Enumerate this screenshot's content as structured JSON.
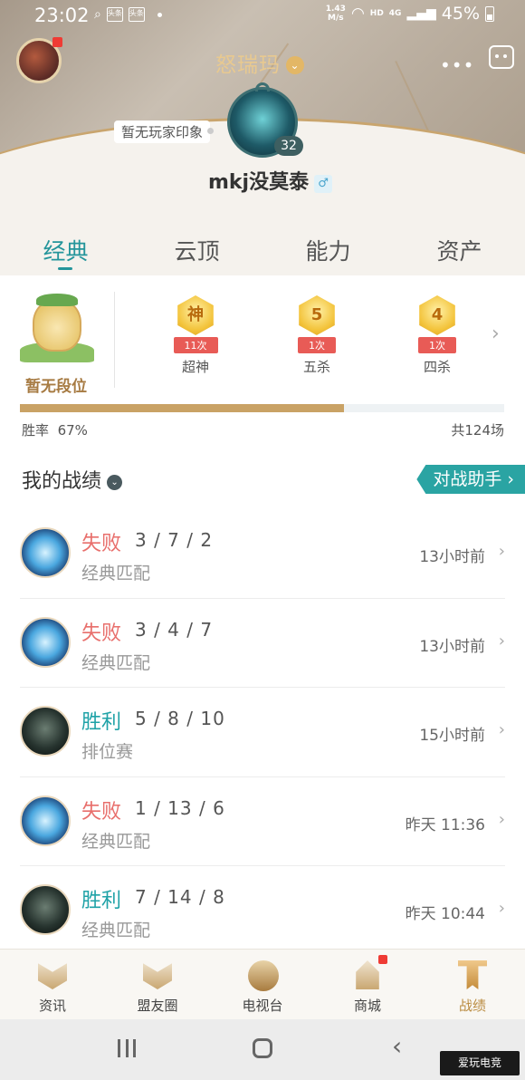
{
  "status_bar": {
    "time": "23:02",
    "notif_icons": [
      "头条",
      "头条"
    ],
    "net_speed_value": "1.43",
    "net_speed_unit": "M/s",
    "hd": "HD",
    "network": "4G",
    "battery": "45%"
  },
  "header": {
    "server_name": "怒瑞玛",
    "impression_tag": "暂无玩家印象",
    "level": "32",
    "player_name": "mkj没莫泰",
    "gender_symbol": "♂",
    "more_symbol": "•••"
  },
  "tabs": [
    {
      "label": "经典",
      "active": true
    },
    {
      "label": "云顶",
      "active": false
    },
    {
      "label": "能力",
      "active": false
    },
    {
      "label": "资产",
      "active": false
    }
  ],
  "summary": {
    "rank_label": "暂无段位",
    "medals": [
      {
        "glyph": "神",
        "count": "11次",
        "name": "超神"
      },
      {
        "glyph": "5",
        "count": "1次",
        "name": "五杀"
      },
      {
        "glyph": "4",
        "count": "1次",
        "name": "四杀"
      }
    ],
    "win_rate_label": "胜率",
    "win_rate_value": "67%",
    "win_rate_fraction": 0.67,
    "total_games": "共124场"
  },
  "section": {
    "title": "我的战绩",
    "assistant_button": "对战助手 ›"
  },
  "matches": [
    {
      "result": "失败",
      "outcome": "lose",
      "kda": "3 / 7 / 2",
      "mode": "经典匹配",
      "time": "13小时前",
      "hero_style": "blue"
    },
    {
      "result": "失败",
      "outcome": "lose",
      "kda": "3 / 4 / 7",
      "mode": "经典匹配",
      "time": "13小时前",
      "hero_style": "blue"
    },
    {
      "result": "胜利",
      "outcome": "win",
      "kda": "5 / 8 / 10",
      "mode": "排位赛",
      "time": "15小时前",
      "hero_style": "dark"
    },
    {
      "result": "失败",
      "outcome": "lose",
      "kda": "1 / 13 / 6",
      "mode": "经典匹配",
      "time": "昨天 11:36",
      "hero_style": "blue"
    },
    {
      "result": "胜利",
      "outcome": "win",
      "kda": "7 / 14 / 8",
      "mode": "经典匹配",
      "time": "昨天 10:44",
      "hero_style": "dark"
    }
  ],
  "bottom_nav": [
    {
      "label": "资讯",
      "icon": "news-icon",
      "active": false,
      "badge": false
    },
    {
      "label": "盟友圈",
      "icon": "friends-icon",
      "active": false,
      "badge": false
    },
    {
      "label": "电视台",
      "icon": "tv-icon",
      "active": false,
      "badge": false
    },
    {
      "label": "商城",
      "icon": "shop-icon",
      "active": false,
      "badge": true
    },
    {
      "label": "战绩",
      "icon": "record-icon",
      "active": true,
      "badge": false
    }
  ],
  "colors": {
    "accent_teal": "#24959b",
    "lose_red": "#e86e6b",
    "win_teal": "#1fa2a7",
    "gold": "#c9a265"
  },
  "watermark": "爱玩电竞"
}
